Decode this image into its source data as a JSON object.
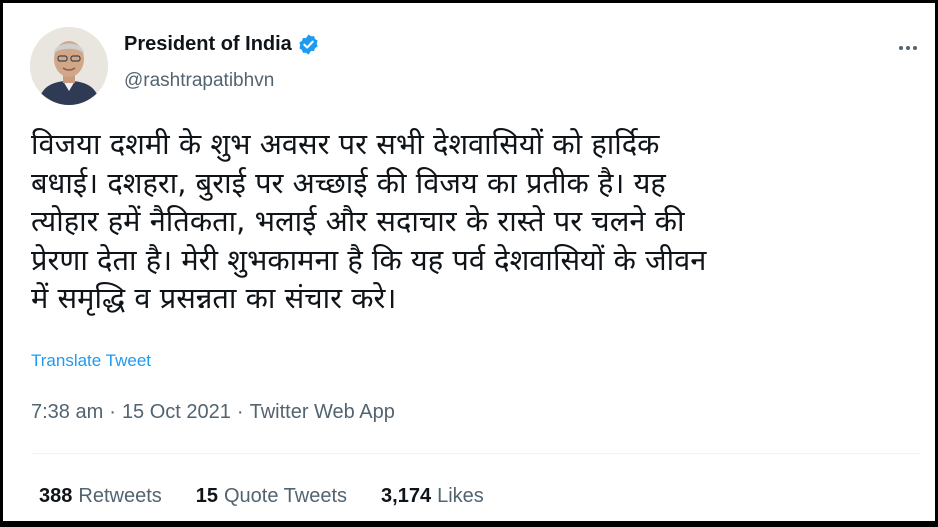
{
  "account": {
    "display_name": "President of India",
    "handle": "@rashtrapatibhvn",
    "verified_icon": "verified-badge-icon",
    "avatar_icon": "profile-avatar"
  },
  "tweet": {
    "text": "विजया दशमी के शुभ अवसर पर सभी देशवासियों को हार्दिक\nबधाई। दशहरा, बुराई पर अच्छाई की विजय का प्रतीक है। यह\nत्योहार हमें नैतिकता, भलाई और सदाचार के रास्ते पर चलने की\nप्रेरणा देता है। मेरी शुभकामना है कि यह पर्व देशवासियों के जीवन\nमें समृद्धि व प्रसन्नता का संचार करे।",
    "translate_label": "Translate Tweet",
    "time": "7:38 am",
    "date": "15 Oct 2021",
    "source": "Twitter Web App",
    "separator": "·"
  },
  "stats": [
    {
      "count": "388",
      "label": "Retweets"
    },
    {
      "count": "15",
      "label": "Quote Tweets"
    },
    {
      "count": "3,174",
      "label": "Likes"
    }
  ],
  "colors": {
    "accent": "#1d9bf0",
    "text_primary": "#0f1419",
    "text_secondary": "#536471"
  },
  "more_icon": "more-options-icon"
}
